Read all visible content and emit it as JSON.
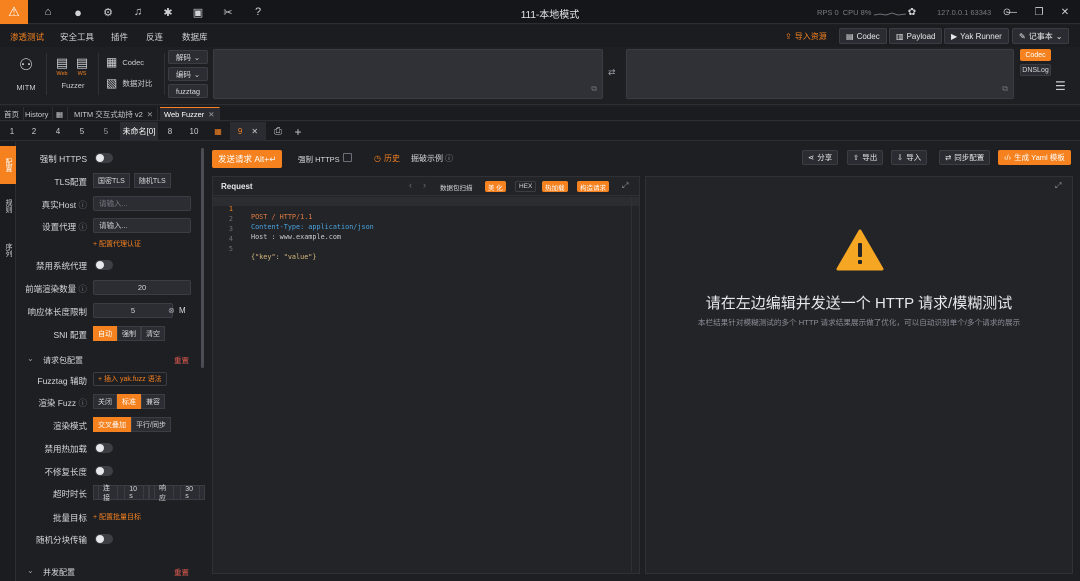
{
  "titlebar": {
    "title": "111-本地模式",
    "rps_label": "RPS 0",
    "cpu_label": "CPU 8%",
    "ip_label": "127.0.0.1 63343"
  },
  "menubar": {
    "items": [
      "渗透测试",
      "安全工具",
      "插件",
      "反连",
      "数据库"
    ],
    "right": {
      "import_label": "导入资源",
      "codec_label": "Codec",
      "payload_label": "Payload",
      "yakrunner_label": "Yak Runner",
      "notebook_label": "记事本"
    }
  },
  "ribbon": {
    "mitm_label": "MITM",
    "fuzzer_label": "Fuzzer",
    "web_label": "Web",
    "ws_label": "WS",
    "dns_label": "DNS",
    "codec_label": "Codec",
    "compare_label": "数据对比",
    "decode_label": "解码",
    "encode_label": "编码",
    "fuzztag_label": "fuzztag",
    "codec_side_label": "Codec",
    "dnslog_label": "DNSLog"
  },
  "pagetabs": {
    "home": "首页",
    "history": "History",
    "mitm": "MITM 交互式劫持 v2",
    "webfuzzer": "Web Fuzzer"
  },
  "numtabs": {
    "tabs": [
      "1",
      "2",
      "4",
      "5",
      "未命名[0]",
      "8",
      "10",
      "9"
    ]
  },
  "vbar": {
    "tab1": "配置",
    "tab2": "规则",
    "tab3": "序列"
  },
  "config": {
    "force_https_label": "强制 HTTPS",
    "tls_label": "TLS配置",
    "tls_opt1": "国密TLS",
    "tls_opt2": "随机TLS",
    "realhost_label": "真实Host",
    "realhost_placeholder": "请输入...",
    "proxy_label": "设置代理",
    "proxy_placeholder": "请输入...",
    "proxy_auth_link": "+ 配置代理认证",
    "disable_sys_proxy_label": "禁用系统代理",
    "render_count_label": "前端渲染数量",
    "render_count_value": "20",
    "resp_len_label": "响应体长度限制",
    "resp_len_value": "5",
    "resp_len_unit": "M",
    "sni_label": "SNI 配置",
    "sni_opts": [
      "自动",
      "强制",
      "清空"
    ],
    "req_pkg_section": "请求包配置",
    "reset_label": "重置",
    "fuzztag_help_label": "Fuzztag 辅助",
    "fuzztag_insert_link": "+ 插入 yak.fuzz 语法",
    "render_fuzz_label": "渲染 Fuzz",
    "render_fuzz_opts": [
      "关闭",
      "标准",
      "兼容"
    ],
    "render_mode_label": "渲染模式",
    "render_mode_opts": [
      "交叉叠加",
      "平行/同步"
    ],
    "disable_hotload_label": "禁用热加载",
    "no_fix_len_label": "不修复长度",
    "timeout_label": "超时时长",
    "timeout_connect_label": "连接",
    "timeout_connect_value": "10 s",
    "timeout_resp_label": "响应",
    "timeout_resp_value": "30 s",
    "batch_target_label": "批量目标",
    "batch_target_link": "+ 配置批量目标",
    "random_chunk_label": "随机分块传输",
    "concurrency_section": "并发配置"
  },
  "toolbar": {
    "send_label": "发送请求 Alt+↵",
    "force_https_label": "强制 HTTPS",
    "history_label": "历史",
    "example_label": "掘破示例",
    "share_label": "分享",
    "export_label": "导出",
    "import_label": "导入",
    "sync_label": "同步配置",
    "yaml_label": "生成 Yaml 模板"
  },
  "request": {
    "title": "Request",
    "buttons": [
      "数据包扫描",
      "美 化",
      "HEX",
      "热加载",
      "构造请求"
    ],
    "lines": [
      {
        "n": "1",
        "text": "POST / HTTP/1.1"
      },
      {
        "n": "2",
        "text": "Content-Type: application/json"
      },
      {
        "n": "3",
        "text": "Host : www.example.com"
      },
      {
        "n": "4",
        "text": ""
      },
      {
        "n": "5",
        "text": "{\"key\": \"value\"}"
      }
    ]
  },
  "response": {
    "title": "请在左边编辑并发送一个 HTTP 请求/模糊测试",
    "subtitle": "本栏结果针对模糊测试的多个 HTTP 请求结果展示做了优化，可以自动识别单个/多个请求的展示"
  },
  "colors": {
    "accent": "#f5821f",
    "bg": "#1e1f23",
    "danger": "#e05a4f",
    "warning_icon": "#f5a623"
  }
}
